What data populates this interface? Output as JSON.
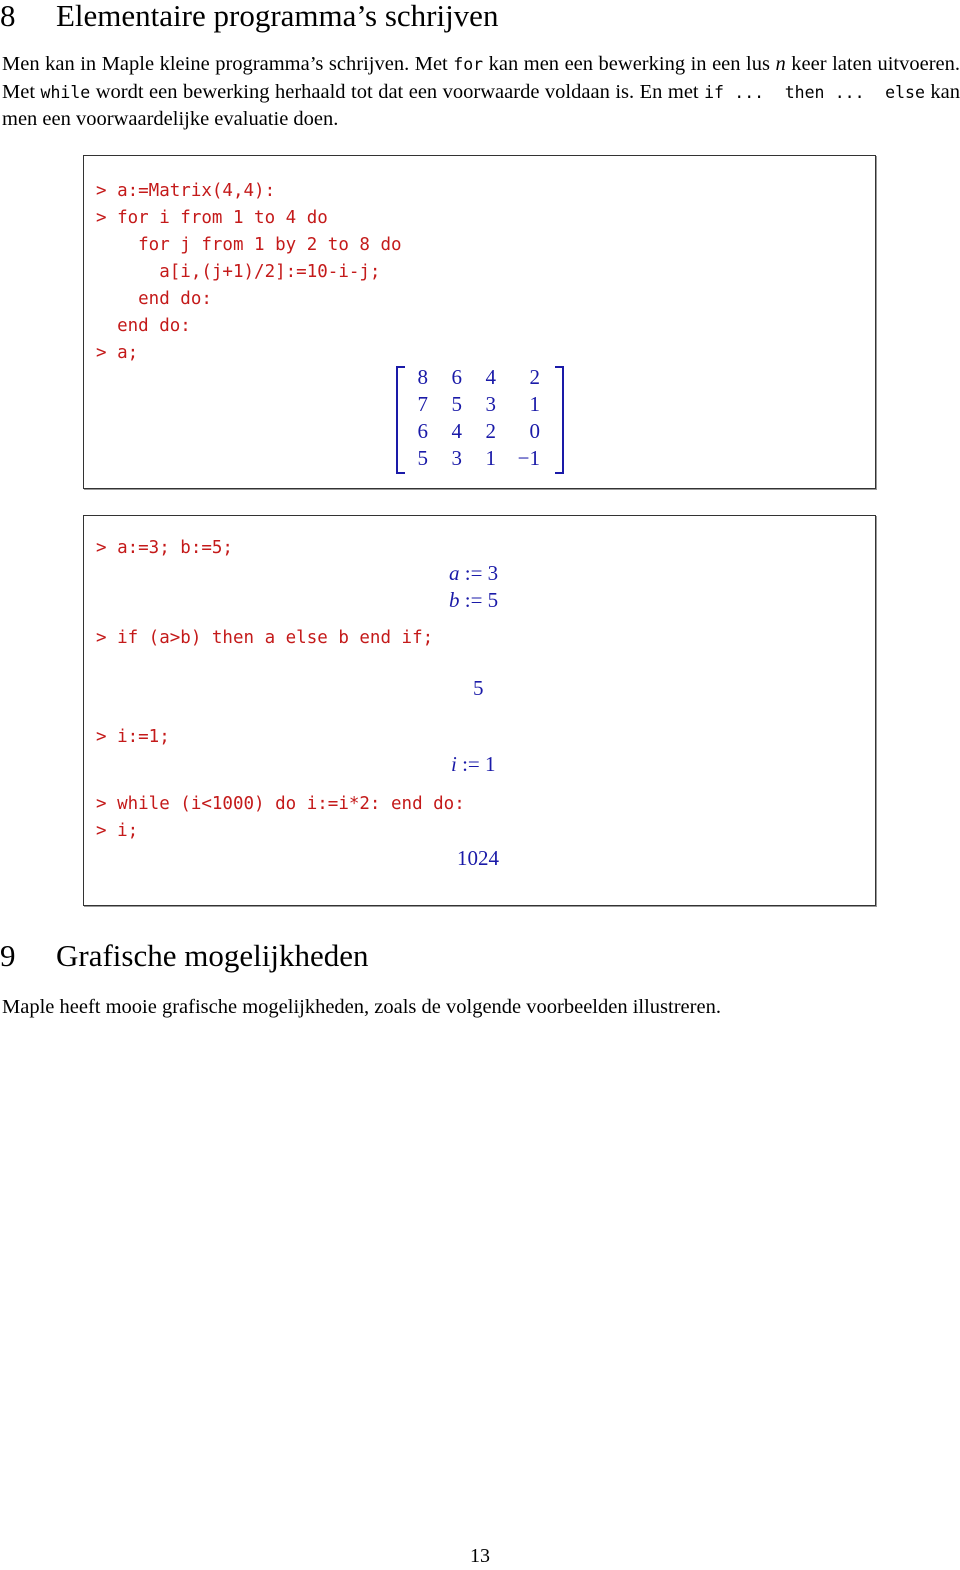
{
  "section8": {
    "number": "8",
    "title": "Elementaire programma’s schrijven",
    "intro": {
      "t1": "Men kan in Maple kleine programma’s schrijven. Met ",
      "c1": "for",
      "t2": " kan men een bewerking in een lus ",
      "var_n": "n",
      "t3": " keer laten uitvoeren. Met ",
      "c2": "while",
      "t4": " wordt een bewerking herhaald tot dat een voorwaarde voldaan is. En met ",
      "c3": "if ...  then ...  else",
      "t5": " kan men een voorwaardelijke evaluatie doen."
    }
  },
  "box1": {
    "lines": [
      "> a:=Matrix(4,4):",
      "> for i from 1 to 4 do",
      "    for j from 1 by 2 to 8 do",
      "      a[i,(j+1)/2]:=10-i-j;",
      "    end do:",
      "  end do:",
      "> a;"
    ],
    "matrix": [
      [
        "8",
        "6",
        "4",
        "2"
      ],
      [
        "7",
        "5",
        "3",
        "1"
      ],
      [
        "6",
        "4",
        "2",
        "0"
      ],
      [
        "5",
        "3",
        "1",
        "−1"
      ]
    ]
  },
  "box2": {
    "cmd1": "> a:=3; b:=5;",
    "out_a_var": "a",
    "out_a_val": " := 3",
    "out_b_var": "b",
    "out_b_val": " := 5",
    "cmd2": "> if (a>b) then a else b end if;",
    "out2": "5",
    "cmd3": "> i:=1;",
    "out3_var": "i",
    "out3_val": " := 1",
    "cmd4": "> while (i<1000) do i:=i*2: end do:",
    "cmd5": "> i;",
    "out5": "1024"
  },
  "section9": {
    "number": "9",
    "title": "Grafische mogelijkheden",
    "intro": "Maple heeft mooie grafische mogelijkheden, zoals de volgende voorbeelden illustreren."
  },
  "colors": {
    "input": "#c41a1a",
    "output": "#1a1aa8"
  },
  "page_number": "13"
}
